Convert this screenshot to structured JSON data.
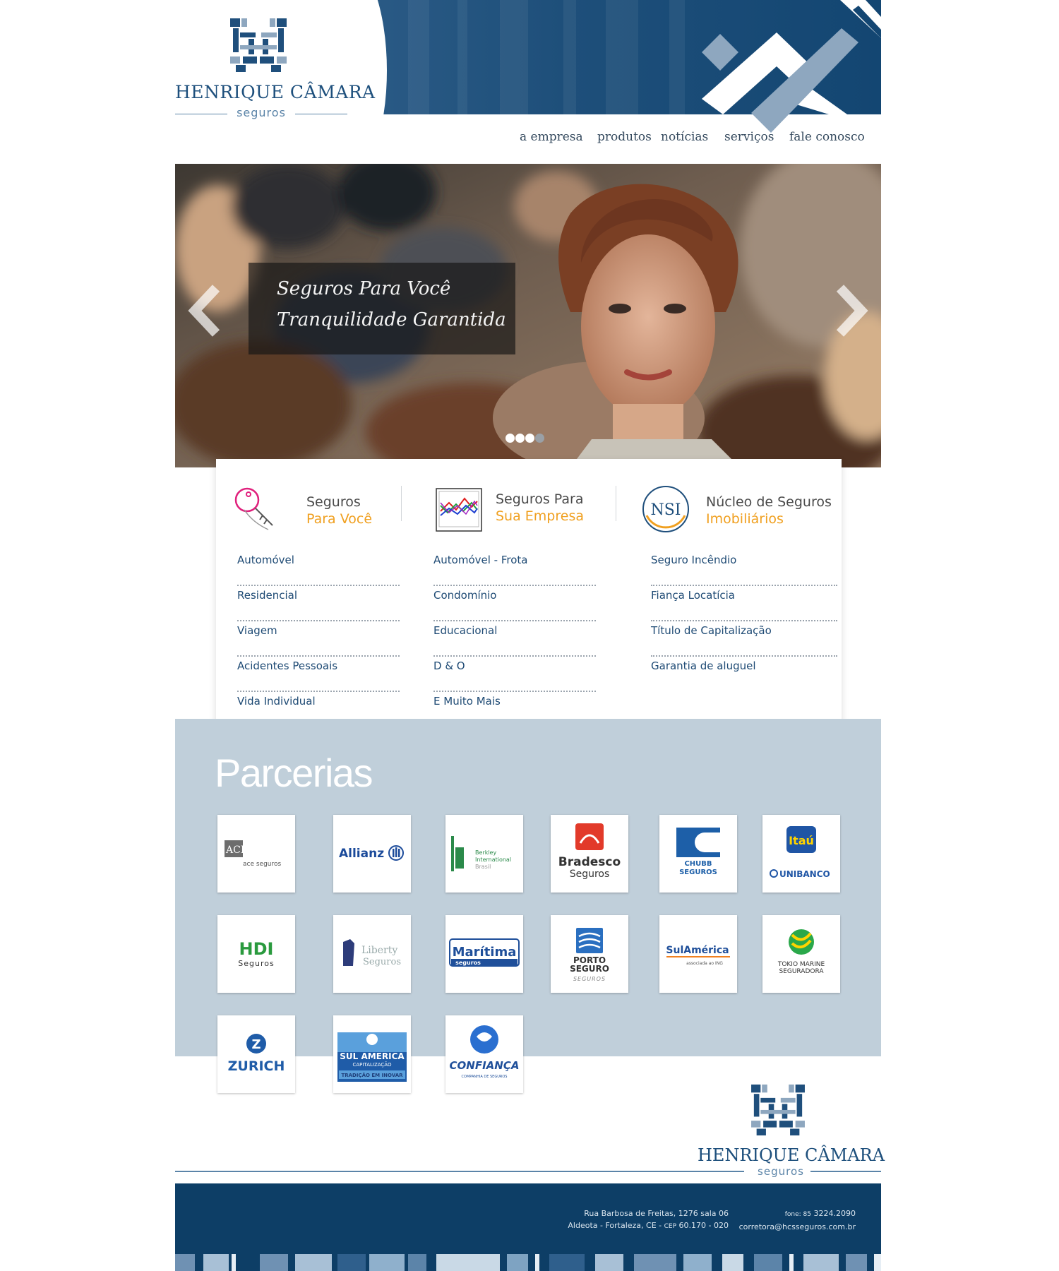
{
  "header": {
    "logo_name": "HENRIQUE CÂMARA",
    "logo_sub": "seguros"
  },
  "nav": {
    "items": [
      "a empresa",
      "produtos",
      "notícias",
      "serviços",
      "fale conosco"
    ]
  },
  "hero": {
    "caption_line1": "Seguros Para Você",
    "caption_line2": "Tranquilidade Garantida",
    "slide_count": 4,
    "active_slide": 3
  },
  "services": {
    "columns": [
      {
        "title1": "Seguros",
        "title2": "Para Você",
        "icon": "key-icon",
        "items": [
          "Automóvel",
          "Residencial",
          "Viagem",
          "Acidentes Pessoais",
          "Vida Individual"
        ]
      },
      {
        "title1": "Seguros Para",
        "title2": "Sua Empresa",
        "icon": "chart-icon",
        "items": [
          "Automóvel - Frota",
          "Condomínio",
          "Educacional",
          "D & O",
          "E Muito Mais"
        ]
      },
      {
        "title1": "Núcleo de Seguros",
        "title2": "Imobiliários",
        "icon": "nsi-logo-icon",
        "icon_text": "NSI",
        "items": [
          "Seguro Incêndio",
          "Fiança Locatícia",
          "Título de Capitalização",
          "Garantia de aluguel"
        ]
      }
    ]
  },
  "partners": {
    "title": "Parcerias",
    "logos": {
      "ace": "ace seguros",
      "allianz": "Allianz",
      "berkley1": "Berkley",
      "berkley2": "International",
      "berkley3": "Brasil",
      "bradesco1": "Bradesco",
      "bradesco2": "Seguros",
      "chubb1": "CHUBB",
      "chubb2": "SEGUROS",
      "itau1": "Itaú",
      "itau2": "UNIBANCO",
      "hdi1": "HDI",
      "hdi2": "Seguros",
      "liberty1": "Liberty",
      "liberty2": "Seguros",
      "maritima1": "Marítima",
      "maritima2": "seguros",
      "porto1": "PORTO",
      "porto2": "SEGURO",
      "porto3": "SEGUROS",
      "sulamerica1": "SulAmérica",
      "sulamerica2": "associada ao ING",
      "tokio1": "TOKIO MARINE",
      "tokio2": "SEGURADORA",
      "zurich": "ZURICH",
      "sulcap1": "SUL AMERICA",
      "sulcap2": "CAPITALIZAÇÃO",
      "sulcap3": "TRADIÇÃO EM INOVAR",
      "confianca1": "CONFIANÇA",
      "confianca2": "COMPANHIA DE SEGUROS"
    }
  },
  "footer_logo": {
    "name": "HENRIQUE CÂMARA",
    "sub": "seguros"
  },
  "footer": {
    "address_line1": "Rua Barbosa de Freitas, 1276 sala 06",
    "address_line2_a": "Aldeota - Fortaleza, CE - ",
    "address_line2_b": "CEP",
    "address_line2_c": " 60.170 - 020",
    "phone_label": "fone: 85",
    "phone": " 3224.2090",
    "email": "corretora@hcsseguros.com.br"
  },
  "colors": {
    "brand_blue": "#134672",
    "accent_orange": "#f0a020",
    "partners_bg": "#c0cfda",
    "footer_bg": "#0d3e66"
  }
}
